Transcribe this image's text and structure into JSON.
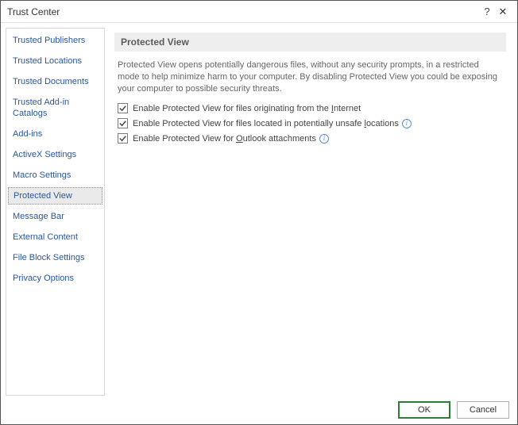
{
  "window": {
    "title": "Trust Center"
  },
  "sidebar": {
    "items": [
      {
        "label": "Trusted Publishers"
      },
      {
        "label": "Trusted Locations"
      },
      {
        "label": "Trusted Documents"
      },
      {
        "label": "Trusted Add-in Catalogs"
      },
      {
        "label": "Add-ins"
      },
      {
        "label": "ActiveX Settings"
      },
      {
        "label": "Macro Settings"
      },
      {
        "label": "Protected View"
      },
      {
        "label": "Message Bar"
      },
      {
        "label": "External Content"
      },
      {
        "label": "File Block Settings"
      },
      {
        "label": "Privacy Options"
      }
    ],
    "selectedIndex": 7
  },
  "main": {
    "header": "Protected View",
    "description": "Protected View opens potentially dangerous files, without any security prompts, in a restricted mode to help minimize harm to your computer. By disabling Protected View you could be exposing your computer to possible security threats.",
    "options": [
      {
        "label_pre": "Enable Protected View for files originating from the ",
        "accel": "I",
        "label_post": "nternet",
        "checked": true,
        "info": false
      },
      {
        "label_pre": "Enable Protected View for files located in potentially unsafe ",
        "accel": "l",
        "label_post": "ocations",
        "checked": true,
        "info": true
      },
      {
        "label_pre": "Enable Protected View for ",
        "accel": "O",
        "label_post": "utlook attachments",
        "checked": true,
        "info": true
      }
    ]
  },
  "footer": {
    "ok": "OK",
    "cancel": "Cancel"
  }
}
